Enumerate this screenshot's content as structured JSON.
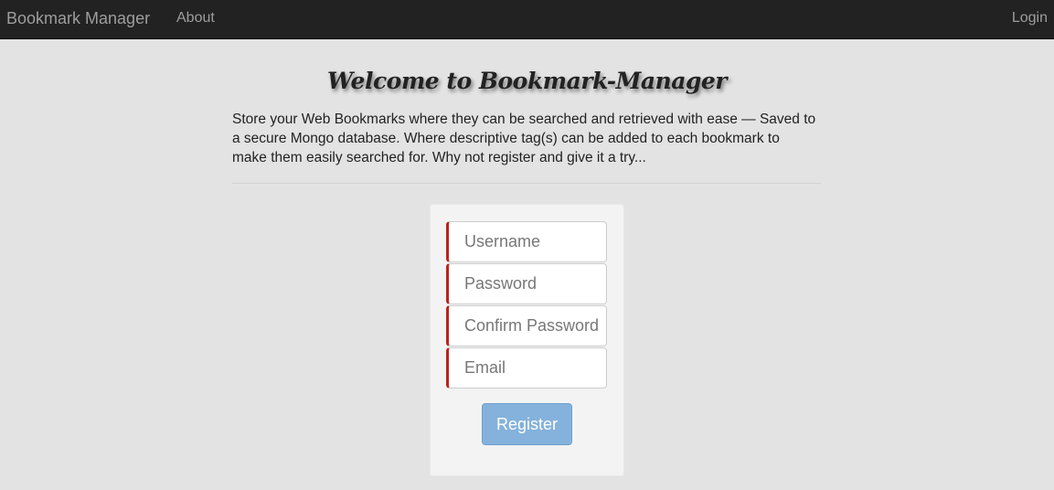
{
  "navbar": {
    "brand": "Bookmark Manager",
    "about": "About",
    "login": "Login",
    "background": "#222222"
  },
  "main": {
    "title": "Welcome to Bookmark-Manager",
    "intro": "Store your Web Bookmarks where they can be searched and retrieved with ease — Saved to a secure Mongo database. Where descriptive tag(s) can be added to each bookmark to make them easily searched for. Why not register and give it a try..."
  },
  "form": {
    "username_placeholder": "Username",
    "password_placeholder": "Password",
    "confirm_placeholder": "Confirm Password",
    "email_placeholder": "Email",
    "register_label": "Register",
    "accent_color": "#b9231d",
    "button_color": "#84b2dc"
  }
}
